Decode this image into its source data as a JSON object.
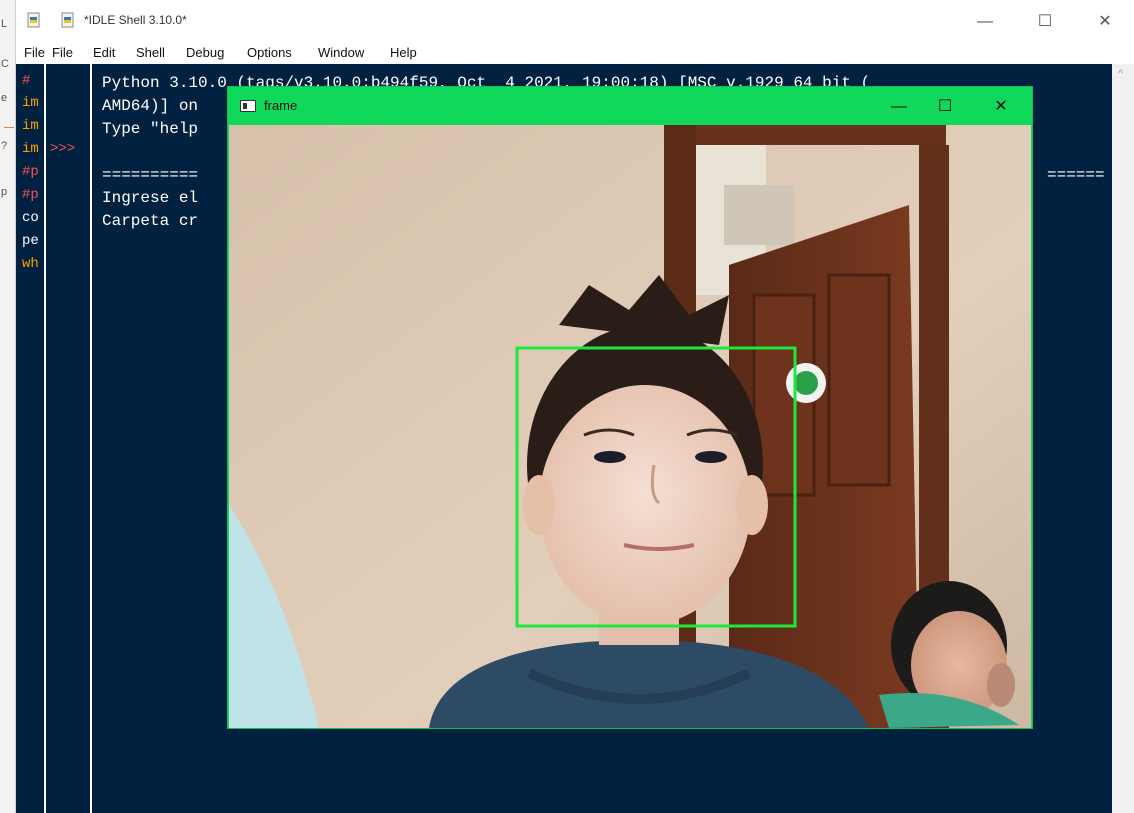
{
  "bg_editor_fragments": [
    "L",
    "C",
    "e",
    "?",
    "p"
  ],
  "idle": {
    "title": "*IDLE Shell 3.10.0*",
    "window_controls": {
      "minimize": "—",
      "maximize": "☐",
      "close": "✕"
    },
    "menu": [
      "File",
      "File",
      "Edit",
      "Shell",
      "Debug",
      "Options",
      "Window",
      "Help"
    ]
  },
  "gutter_left": [
    {
      "text": "#",
      "color": "#ff4d4d"
    },
    {
      "text": "im",
      "color": "#ff9d00"
    },
    {
      "text": "im",
      "color": "#ff9d00"
    },
    {
      "text": "im",
      "color": "#ff9d00"
    },
    {
      "text": "#p",
      "color": "#ff4d4d"
    },
    {
      "text": "#p",
      "color": "#ff4d4d"
    },
    {
      "text": "co",
      "color": "#ffffff"
    },
    {
      "text": "pe",
      "color": "#ffffff"
    },
    {
      "text": "wh",
      "color": "#ff9d00"
    }
  ],
  "prompt": ">>>",
  "shell_lines": [
    "Python 3.10.0 (tags/v3.10.0:b494f59, Oct  4 2021, 19:00:18) [MSC v.1929 64 bit (",
    "AMD64)] on",
    "Type \"help",
    "",
    "==========",
    "Ingrese el",
    "Carpeta cr"
  ],
  "shell_rule_right": "======",
  "frame_window": {
    "title": "frame",
    "window_controls": {
      "minimize": "—",
      "maximize": "☐",
      "close": "✕"
    }
  },
  "colors": {
    "shell_bg": "#002240",
    "frame_titlebar": "#10d85a",
    "detection_box": "#1ee83c"
  }
}
